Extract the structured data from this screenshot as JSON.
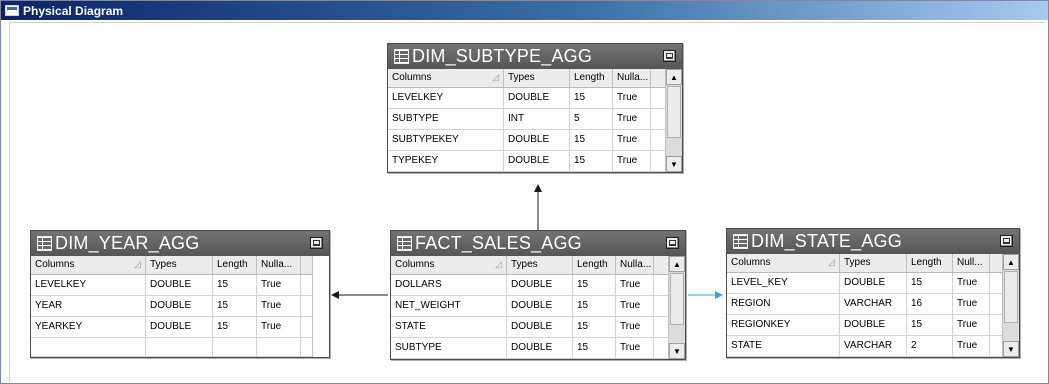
{
  "window": {
    "title": "Physical Diagram"
  },
  "colors": {
    "connector_dark": "#1a1a1a",
    "connector_selected": "#3aa0e8",
    "table_header": "#5e5e5e"
  },
  "tables": {
    "subtype": {
      "name": "DIM_SUBTYPE_AGG",
      "columns": [
        "Columns",
        "Types",
        "Length",
        "Nulla..."
      ],
      "rows": [
        [
          "LEVELKEY",
          "DOUBLE",
          "15",
          "True"
        ],
        [
          "SUBTYPE",
          "INT",
          "5",
          "True"
        ],
        [
          "SUBTYPEKEY",
          "DOUBLE",
          "15",
          "True"
        ],
        [
          "TYPEKEY",
          "DOUBLE",
          "15",
          "True"
        ]
      ]
    },
    "year": {
      "name": "DIM_YEAR_AGG",
      "columns": [
        "Columns",
        "Types",
        "Length",
        "Nulla..."
      ],
      "rows": [
        [
          "LEVELKEY",
          "DOUBLE",
          "15",
          "True"
        ],
        [
          "YEAR",
          "DOUBLE",
          "15",
          "True"
        ],
        [
          "YEARKEY",
          "DOUBLE",
          "15",
          "True"
        ]
      ]
    },
    "fact": {
      "name": "FACT_SALES_AGG",
      "columns": [
        "Columns",
        "Types",
        "Length",
        "Nulla..."
      ],
      "rows": [
        [
          "DOLLARS",
          "DOUBLE",
          "15",
          "True"
        ],
        [
          "NET_WEIGHT",
          "DOUBLE",
          "15",
          "True"
        ],
        [
          "STATE",
          "DOUBLE",
          "15",
          "True"
        ],
        [
          "SUBTYPE",
          "DOUBLE",
          "15",
          "True"
        ]
      ]
    },
    "state": {
      "name": "DIM_STATE_AGG",
      "columns": [
        "Columns",
        "Types",
        "Length",
        "Null..."
      ],
      "rows": [
        [
          "LEVEL_KEY",
          "DOUBLE",
          "15",
          "True"
        ],
        [
          "REGION",
          "VARCHAR",
          "16",
          "True"
        ],
        [
          "REGIONKEY",
          "DOUBLE",
          "15",
          "True"
        ],
        [
          "STATE",
          "VARCHAR",
          "2",
          "True"
        ]
      ]
    }
  }
}
